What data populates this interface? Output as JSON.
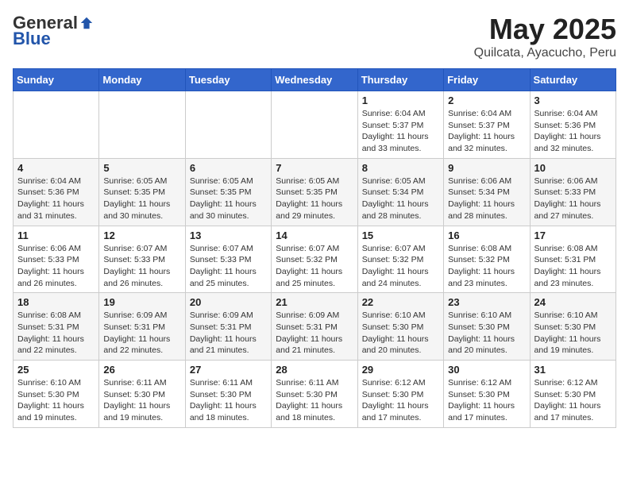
{
  "logo": {
    "general": "General",
    "blue": "Blue"
  },
  "title": "May 2025",
  "location": "Quilcata, Ayacucho, Peru",
  "days_of_week": [
    "Sunday",
    "Monday",
    "Tuesday",
    "Wednesday",
    "Thursday",
    "Friday",
    "Saturday"
  ],
  "weeks": [
    [
      {
        "day": "",
        "info": ""
      },
      {
        "day": "",
        "info": ""
      },
      {
        "day": "",
        "info": ""
      },
      {
        "day": "",
        "info": ""
      },
      {
        "day": "1",
        "info": "Sunrise: 6:04 AM\nSunset: 5:37 PM\nDaylight: 11 hours and 33 minutes."
      },
      {
        "day": "2",
        "info": "Sunrise: 6:04 AM\nSunset: 5:37 PM\nDaylight: 11 hours and 32 minutes."
      },
      {
        "day": "3",
        "info": "Sunrise: 6:04 AM\nSunset: 5:36 PM\nDaylight: 11 hours and 32 minutes."
      }
    ],
    [
      {
        "day": "4",
        "info": "Sunrise: 6:04 AM\nSunset: 5:36 PM\nDaylight: 11 hours and 31 minutes."
      },
      {
        "day": "5",
        "info": "Sunrise: 6:05 AM\nSunset: 5:35 PM\nDaylight: 11 hours and 30 minutes."
      },
      {
        "day": "6",
        "info": "Sunrise: 6:05 AM\nSunset: 5:35 PM\nDaylight: 11 hours and 30 minutes."
      },
      {
        "day": "7",
        "info": "Sunrise: 6:05 AM\nSunset: 5:35 PM\nDaylight: 11 hours and 29 minutes."
      },
      {
        "day": "8",
        "info": "Sunrise: 6:05 AM\nSunset: 5:34 PM\nDaylight: 11 hours and 28 minutes."
      },
      {
        "day": "9",
        "info": "Sunrise: 6:06 AM\nSunset: 5:34 PM\nDaylight: 11 hours and 28 minutes."
      },
      {
        "day": "10",
        "info": "Sunrise: 6:06 AM\nSunset: 5:33 PM\nDaylight: 11 hours and 27 minutes."
      }
    ],
    [
      {
        "day": "11",
        "info": "Sunrise: 6:06 AM\nSunset: 5:33 PM\nDaylight: 11 hours and 26 minutes."
      },
      {
        "day": "12",
        "info": "Sunrise: 6:07 AM\nSunset: 5:33 PM\nDaylight: 11 hours and 26 minutes."
      },
      {
        "day": "13",
        "info": "Sunrise: 6:07 AM\nSunset: 5:33 PM\nDaylight: 11 hours and 25 minutes."
      },
      {
        "day": "14",
        "info": "Sunrise: 6:07 AM\nSunset: 5:32 PM\nDaylight: 11 hours and 25 minutes."
      },
      {
        "day": "15",
        "info": "Sunrise: 6:07 AM\nSunset: 5:32 PM\nDaylight: 11 hours and 24 minutes."
      },
      {
        "day": "16",
        "info": "Sunrise: 6:08 AM\nSunset: 5:32 PM\nDaylight: 11 hours and 23 minutes."
      },
      {
        "day": "17",
        "info": "Sunrise: 6:08 AM\nSunset: 5:31 PM\nDaylight: 11 hours and 23 minutes."
      }
    ],
    [
      {
        "day": "18",
        "info": "Sunrise: 6:08 AM\nSunset: 5:31 PM\nDaylight: 11 hours and 22 minutes."
      },
      {
        "day": "19",
        "info": "Sunrise: 6:09 AM\nSunset: 5:31 PM\nDaylight: 11 hours and 22 minutes."
      },
      {
        "day": "20",
        "info": "Sunrise: 6:09 AM\nSunset: 5:31 PM\nDaylight: 11 hours and 21 minutes."
      },
      {
        "day": "21",
        "info": "Sunrise: 6:09 AM\nSunset: 5:31 PM\nDaylight: 11 hours and 21 minutes."
      },
      {
        "day": "22",
        "info": "Sunrise: 6:10 AM\nSunset: 5:30 PM\nDaylight: 11 hours and 20 minutes."
      },
      {
        "day": "23",
        "info": "Sunrise: 6:10 AM\nSunset: 5:30 PM\nDaylight: 11 hours and 20 minutes."
      },
      {
        "day": "24",
        "info": "Sunrise: 6:10 AM\nSunset: 5:30 PM\nDaylight: 11 hours and 19 minutes."
      }
    ],
    [
      {
        "day": "25",
        "info": "Sunrise: 6:10 AM\nSunset: 5:30 PM\nDaylight: 11 hours and 19 minutes."
      },
      {
        "day": "26",
        "info": "Sunrise: 6:11 AM\nSunset: 5:30 PM\nDaylight: 11 hours and 19 minutes."
      },
      {
        "day": "27",
        "info": "Sunrise: 6:11 AM\nSunset: 5:30 PM\nDaylight: 11 hours and 18 minutes."
      },
      {
        "day": "28",
        "info": "Sunrise: 6:11 AM\nSunset: 5:30 PM\nDaylight: 11 hours and 18 minutes."
      },
      {
        "day": "29",
        "info": "Sunrise: 6:12 AM\nSunset: 5:30 PM\nDaylight: 11 hours and 17 minutes."
      },
      {
        "day": "30",
        "info": "Sunrise: 6:12 AM\nSunset: 5:30 PM\nDaylight: 11 hours and 17 minutes."
      },
      {
        "day": "31",
        "info": "Sunrise: 6:12 AM\nSunset: 5:30 PM\nDaylight: 11 hours and 17 minutes."
      }
    ]
  ]
}
